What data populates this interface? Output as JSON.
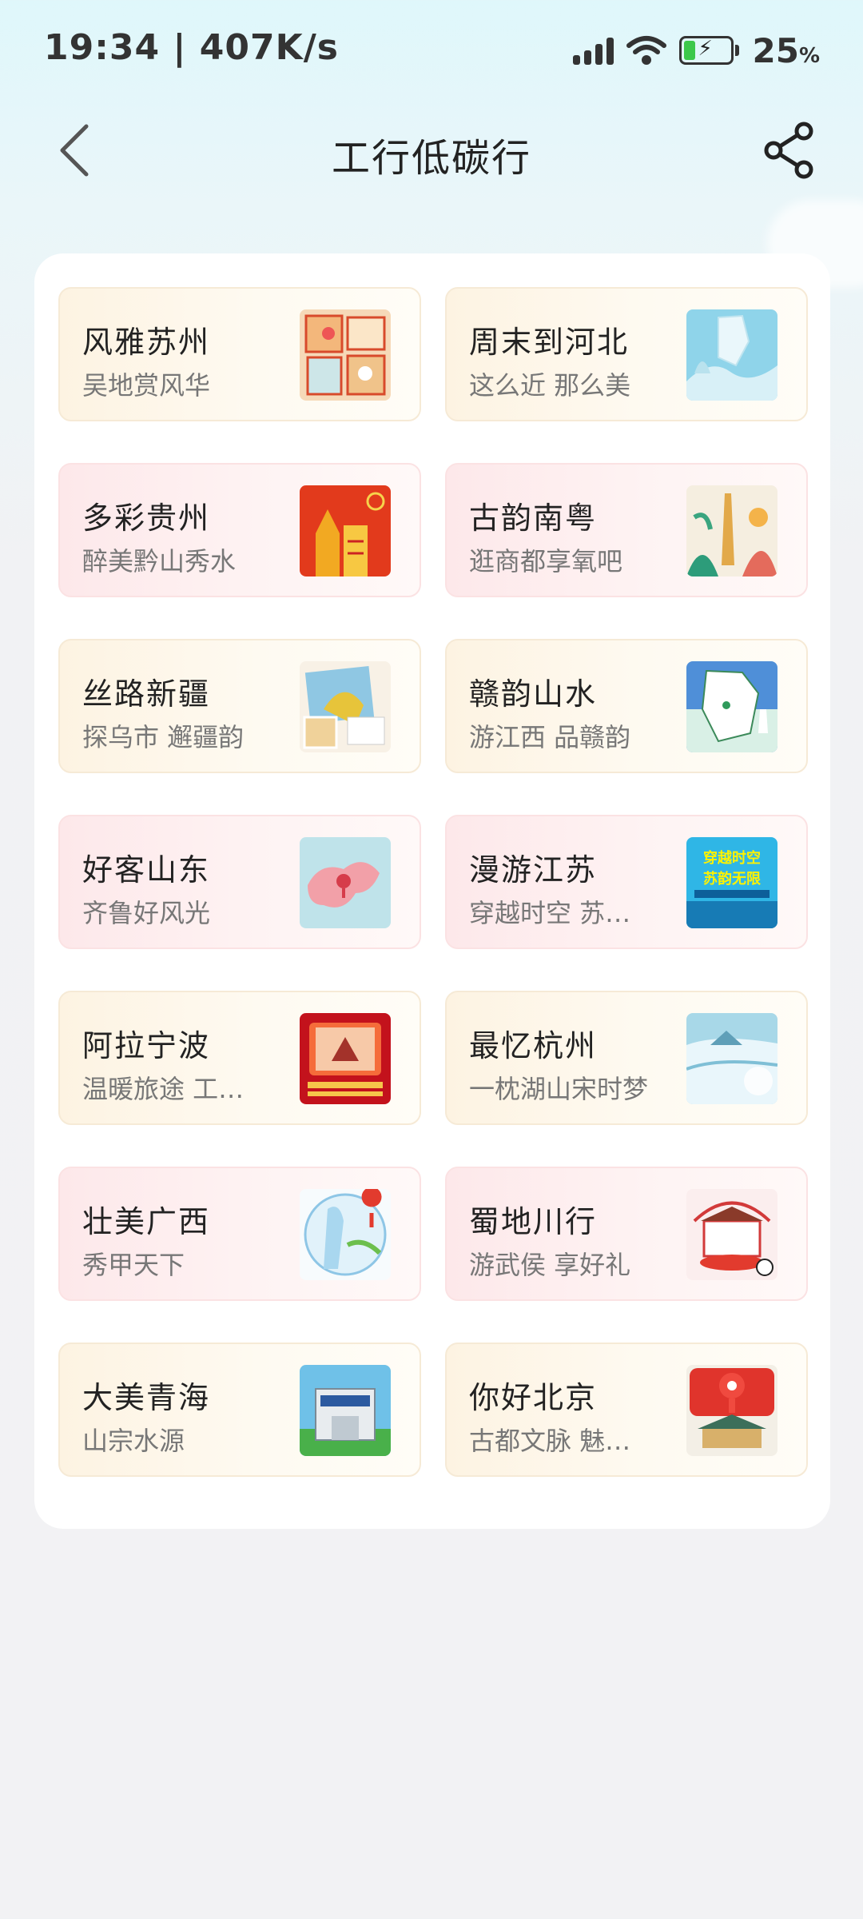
{
  "status_bar": {
    "time": "19:34 | 407K/s",
    "battery_percent": "25",
    "battery_unit": "%",
    "battery_level": 0.25,
    "battery_color": "#3cc84b",
    "icons": [
      "signal-icon",
      "wifi-icon",
      "battery-charging-icon"
    ]
  },
  "header": {
    "title": "工行低碳行",
    "back_icon": "chevron-left-icon",
    "share_icon": "share-icon"
  },
  "cards": [
    {
      "title": "风雅苏州",
      "subtitle": "吴地赏风华",
      "style": "gold"
    },
    {
      "title": "周末到河北",
      "subtitle": "这么近 那么美",
      "style": "gold"
    },
    {
      "title": "多彩贵州",
      "subtitle": "醉美黔山秀水",
      "style": "pink"
    },
    {
      "title": "古韵南粤",
      "subtitle": "逛商都享氧吧",
      "style": "pink"
    },
    {
      "title": "丝路新疆",
      "subtitle": "探乌市 邂疆韵",
      "style": "gold"
    },
    {
      "title": "赣韵山水",
      "subtitle": "游江西 品赣韵",
      "style": "gold"
    },
    {
      "title": "好客山东",
      "subtitle": "齐鲁好风光",
      "style": "pink"
    },
    {
      "title": "漫游江苏",
      "subtitle": "穿越时空 苏…",
      "style": "pink"
    },
    {
      "title": "阿拉宁波",
      "subtitle": "温暖旅途 工…",
      "style": "gold"
    },
    {
      "title": "最忆杭州",
      "subtitle": "一枕湖山宋时梦",
      "style": "gold"
    },
    {
      "title": "壮美广西",
      "subtitle": "秀甲天下",
      "style": "pink"
    },
    {
      "title": "蜀地川行",
      "subtitle": "游武侯 享好礼",
      "style": "pink"
    },
    {
      "title": "大美青海",
      "subtitle": "山宗水源",
      "style": "gold"
    },
    {
      "title": "你好北京",
      "subtitle": "古都文脉 魅…",
      "style": "gold"
    }
  ],
  "thumb_text": {
    "jiangsu": "穿越时空 苏韵无限"
  }
}
